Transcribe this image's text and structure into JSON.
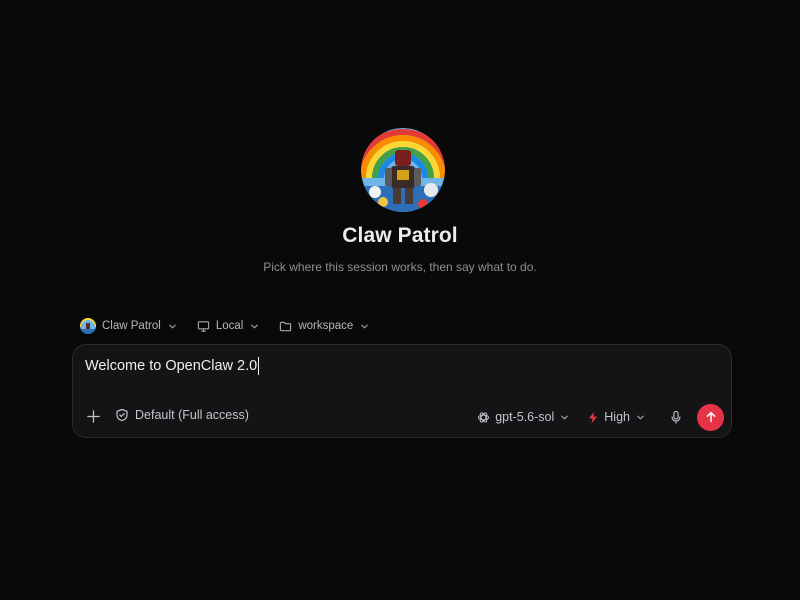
{
  "agent": {
    "name": "Claw Patrol",
    "subtitle": "Pick where this session works, then say what to do.",
    "avatar_icon": "robot-rainbow-avatar"
  },
  "selectors": {
    "agent_label": "Claw Patrol",
    "environment_label": "Local",
    "environment_icon": "monitor-icon",
    "folder_label": "workspace",
    "folder_icon": "folder-icon"
  },
  "composer": {
    "value": "Welcome to OpenClaw 2.0",
    "permission_label": "Default (Full access)",
    "permission_icon": "shield-icon",
    "model_label": "gpt-5.6-sol",
    "model_icon": "openai-icon",
    "effort_label": "High",
    "effort_icon": "bolt-icon",
    "effort_color": "#e63446",
    "send_color": "#e63446"
  }
}
